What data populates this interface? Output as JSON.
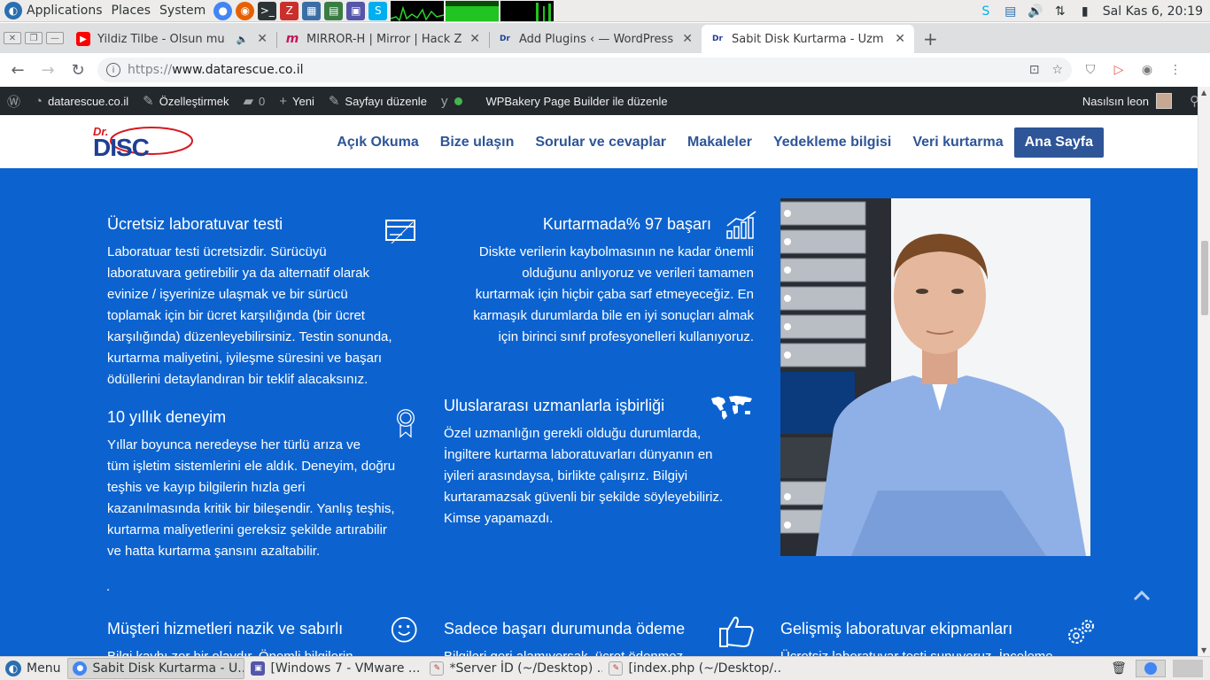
{
  "top_panel": {
    "applications": "Applications",
    "places": "Places",
    "system": "System",
    "clock": "Sal Kas  6, 20:19"
  },
  "tabs": [
    {
      "title": "Yildiz Tilbe - Olsun mu",
      "icon": "youtube-icon",
      "color": "#ff0000"
    },
    {
      "title": "MIRROR-H | Mirror | Hack Z",
      "icon": "mirror-h-icon",
      "color": "#c2185b"
    },
    {
      "title": "Add Plugins ‹ — WordPress",
      "icon": "drdisc-favicon",
      "color": "#1f3f94"
    },
    {
      "title": "Sabit Disk Kurtarma - Uzm",
      "icon": "drdisc-favicon",
      "color": "#1f3f94"
    }
  ],
  "address": {
    "scheme": "https://",
    "host": "www.datarescue.co.il"
  },
  "wpbar": {
    "site": "datarescue.co.il",
    "customize": "Özelleştirmek",
    "comments": "0",
    "new": "Yeni",
    "edit": "Sayfayı düzenle",
    "wpbakery": "WPBakery Page Builder ile düzenle",
    "greeting": "Nasılsın leon"
  },
  "logo": {
    "dr": "Dr.",
    "disc": "DISC"
  },
  "nav": {
    "items": [
      "Açık Okuma",
      "Bize ulaşın",
      "Sorular ve cevaplar",
      "Makaleler",
      "Yedekleme bilgisi",
      "Veri kurtarma"
    ],
    "active": "Ana Sayfa"
  },
  "features": {
    "lab_test": {
      "title": "Ücretsiz laboratuvar testi",
      "lines": [
        "Laboratuar testi ücretsizdir. Sürücüyü",
        "laboratuvara getirebilir ya da alternatif olarak",
        "evinize / işyerinize ulaşmak ve bir sürücü",
        "toplamak için bir ücret karşılığında (bir ücret",
        "karşılığında) düzenleyebilirsiniz. Testin sonunda,",
        "kurtarma maliyetini, iyileşme süresini ve başarı",
        "ödüllerini detaylandıran bir teklif alacaksınız."
      ]
    },
    "success": {
      "title": "Kurtarmada% 97 başarı",
      "lines": [
        "Diskte verilerin kaybolmasının ne kadar önemli",
        "olduğunu anlıyoruz ve verileri tamamen",
        "kurtarmak için hiçbir çaba sarf etmeyeceğiz. En",
        "karmaşık durumlarda bile en iyi sonuçları almak",
        "için birinci sınıf profesyonelleri kullanıyoruz."
      ]
    },
    "experience": {
      "title": "10 yıllık deneyim",
      "lines": [
        "Yıllar boyunca neredeyse her türlü arıza ve",
        "tüm işletim sistemlerini ele aldık. Deneyim, doğru",
        "teşhis ve kayıp bilgilerin hızla geri",
        "kazanılmasında kritik bir bileşendir. Yanlış teşhis,",
        "kurtarma maliyetlerini gereksiz şekilde artırabilir",
        "ve hatta kurtarma şansını azaltabilir."
      ]
    },
    "international": {
      "title": "Uluslararası uzmanlarla işbirliği",
      "lines": [
        "Özel uzmanlığın gerekli olduğu durumlarda,",
        "İngiltere kurtarma laboratuvarları dünyanın en",
        "iyileri arasındaysa, birlikte çalışırız. Bilgiyi",
        "kurtaramazsak güvenli bir şekilde söyleyebiliriz.",
        "Kimse yapamazdı."
      ]
    },
    "service": {
      "title": "Müşteri hizmetleri nazik ve sabırlı",
      "lines": [
        "Bilgi kaybı zor bir olaydır. Önemli bilgilerin"
      ]
    },
    "pay_on_success": {
      "title": "Sadece başarı durumunda ödeme",
      "lines": [
        "Bilgileri geri alamıyorsak, ücret ödenmez"
      ]
    },
    "equipment": {
      "title": "Gelişmiş laboratuvar ekipmanları",
      "lines": [
        "Ücretsiz laboratuvar testi sunuyoruz. İnceleme"
      ]
    }
  },
  "dot": ".",
  "taskbar": {
    "menu": "Menu",
    "tasks": [
      {
        "label": "Sabit Disk Kurtarma - U...",
        "icon": "chrome-icon",
        "active": true
      },
      {
        "label": "[Windows 7 - VMware ...",
        "icon": "vmware-icon",
        "active": false
      },
      {
        "label": "*Server İD (~/Desktop) ...",
        "icon": "text-editor-icon",
        "active": false
      },
      {
        "label": "[index.php (~/Desktop/...",
        "icon": "text-editor-icon",
        "active": false
      }
    ]
  },
  "colors": {
    "content_bg": "#0c63d0",
    "nav_text": "#2e5597",
    "wpbar_bg": "#23282d"
  }
}
